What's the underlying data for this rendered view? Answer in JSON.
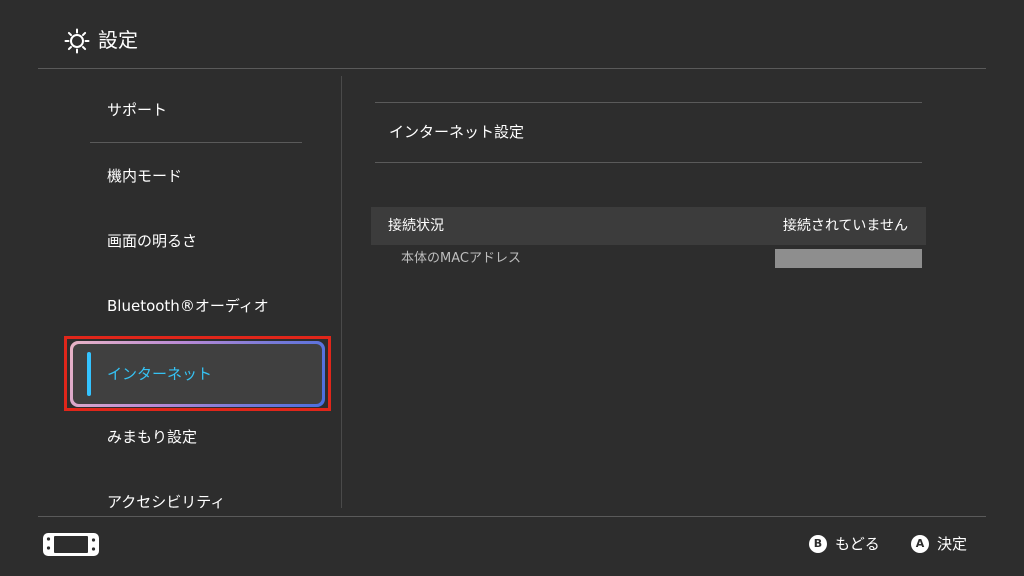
{
  "header": {
    "title": "設定",
    "icon": "gear-icon"
  },
  "sidebar": {
    "items": [
      {
        "label": "サポート"
      },
      {
        "label": "機内モード"
      },
      {
        "label": "画面の明るさ"
      },
      {
        "label": "Bluetooth®オーディオ"
      },
      {
        "label": "インターネット",
        "selected": true
      },
      {
        "label": "みまもり設定"
      },
      {
        "label": "アクセシビリティ"
      }
    ]
  },
  "main": {
    "title": "インターネット設定",
    "status_row": {
      "label": "接続状況",
      "value": "接続されていません"
    },
    "mac_row": {
      "label": "本体のMACアドレス"
    }
  },
  "footer": {
    "console_icon": "switch-console-icon",
    "back": {
      "key": "B",
      "label": "もどる"
    },
    "confirm": {
      "key": "A",
      "label": "決定"
    }
  },
  "colors": {
    "background": "#2d2d2d",
    "selected_text": "#35c2f3",
    "highlight_border": "#e0261a",
    "mac_mask": "#8e8e8e"
  }
}
